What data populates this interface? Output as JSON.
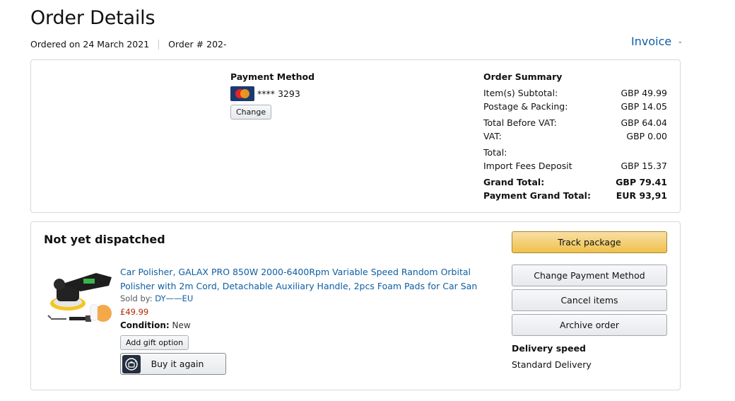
{
  "header": {
    "title": "Order Details",
    "ordered_on": "Ordered on 24 March 2021",
    "order_number": "Order # 202-",
    "invoice_label": "Invoice"
  },
  "payment": {
    "title": "Payment Method",
    "card_brand_icon": "mastercard-icon",
    "card_mask": "**** 3293",
    "change_label": "Change"
  },
  "summary": {
    "title": "Order Summary",
    "rows": [
      {
        "label": "Item(s) Subtotal:",
        "value": "GBP 49.99"
      },
      {
        "label": "Postage & Packing:",
        "value": "GBP 14.05"
      },
      {
        "label": "Total Before VAT:",
        "value": "GBP 64.04"
      },
      {
        "label": "VAT:",
        "value": "GBP 0.00"
      },
      {
        "label": "Total:",
        "value": ""
      },
      {
        "label": "Import Fees Deposit",
        "value": "GBP 15.37"
      },
      {
        "label": "Grand Total:",
        "value": "GBP 79.41"
      },
      {
        "label": "Payment Grand Total:",
        "value": "EUR 93,91"
      }
    ]
  },
  "shipment": {
    "status": "Not yet dispatched",
    "product": {
      "title": "Car Polisher, GALAX PRO 850W 2000-6400Rpm Variable Speed Random Orbital Polisher with 2m Cord, Detachable Auxiliary Handle, 2pcs Foam Pads for Car San",
      "sold_by_label": "Sold by: ",
      "seller": "DY——EU",
      "price": "£49.99",
      "condition_label": "Condition:",
      "condition_value": " New",
      "gift_label": "Add gift option",
      "buy_again_label": "Buy it again"
    },
    "actions": {
      "track": "Track package",
      "change_payment": "Change Payment Method",
      "cancel": "Cancel items",
      "archive": "Archive order"
    },
    "delivery_speed_title": "Delivery speed",
    "delivery_speed_value": "Standard Delivery"
  },
  "colors": {
    "link": "#0f5ea3",
    "price": "#b12704",
    "primary_button": "#f0c14b"
  }
}
